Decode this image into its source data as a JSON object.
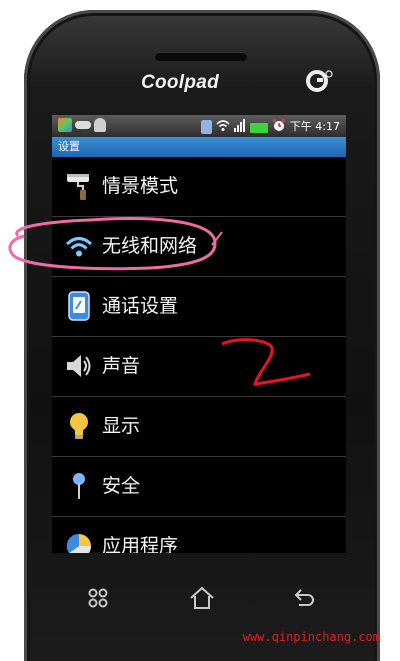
{
  "device": {
    "brand": "Coolpad"
  },
  "statusbar": {
    "time": "下午 4:17"
  },
  "titlebar": {
    "title": "设置"
  },
  "settings": {
    "items": [
      {
        "label": "情景模式",
        "icon": "paint-roller-icon"
      },
      {
        "label": "无线和网络",
        "icon": "wifi-icon"
      },
      {
        "label": "通话设置",
        "icon": "phone-call-icon"
      },
      {
        "label": "声音",
        "icon": "speaker-icon"
      },
      {
        "label": "显示",
        "icon": "lightbulb-icon"
      },
      {
        "label": "安全",
        "icon": "pin-icon"
      },
      {
        "label": "应用程序",
        "icon": "app-pie-icon"
      }
    ]
  },
  "annotation": {
    "step_number": "2"
  },
  "watermark": {
    "text": "www.qinpinchang.com"
  },
  "colors": {
    "titlebar": "#2a78c6",
    "annotation_pink": "#f06aa8",
    "annotation_red": "#e8102a"
  }
}
